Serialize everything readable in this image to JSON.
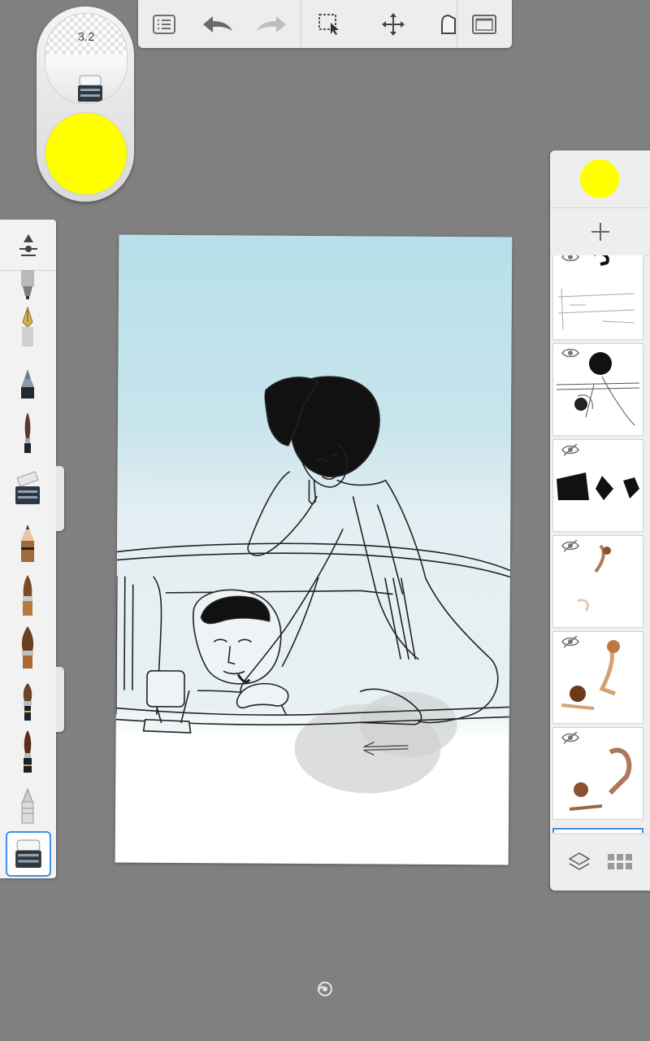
{
  "app": {
    "current_color": "#ffff00",
    "brush_size": "3.2",
    "active_brush": "hard-eraser-icon"
  },
  "toolbar": {
    "items": [
      "list-icon",
      "undo-icon",
      "redo-icon",
      "selection-icon",
      "transform-icon",
      "fill-icon",
      "fullscreen-icon"
    ],
    "redo_enabled": false
  },
  "brushes": {
    "items": [
      "marker-icon",
      "fountain-pen-icon",
      "ballpoint-pen-icon",
      "fine-brush-icon",
      "eraser-icon",
      "pencil-icon",
      "paint-brush-icon",
      "flat-brush-icon",
      "round-brush-icon",
      "ink-brush-icon",
      "airbrush-icon",
      "hard-eraser-icon"
    ],
    "selected_index": 11
  },
  "layers": {
    "color": "#ffff00",
    "items": [
      {
        "name": "layer-1",
        "visible": true
      },
      {
        "name": "layer-2",
        "visible": true
      },
      {
        "name": "layer-3",
        "visible": false
      },
      {
        "name": "layer-4",
        "visible": false
      },
      {
        "name": "layer-5",
        "visible": false
      },
      {
        "name": "layer-6",
        "visible": false
      }
    ],
    "selected_index": 6
  },
  "colors": {
    "sky": "#b6e0ea",
    "accent": "#3d8fe8",
    "background": "#808080"
  }
}
